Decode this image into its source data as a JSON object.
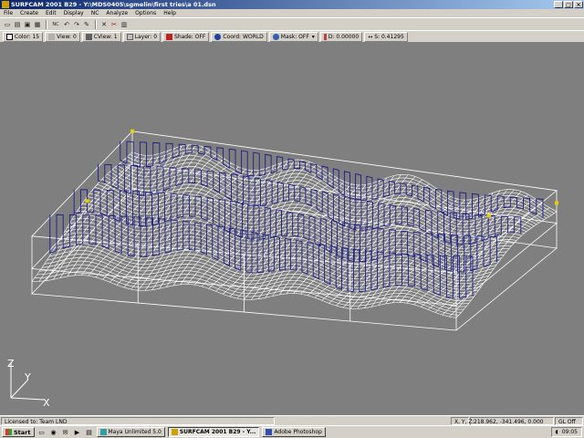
{
  "window": {
    "title": "SURFCAM 2001 B29 - Y:\\MDS0405\\sgmelin\\first tries\\a 01.dsn",
    "minimize": "_",
    "maximize": "□",
    "close": "×"
  },
  "menu": [
    "File",
    "Create",
    "Edit",
    "Display",
    "NC",
    "Analyze",
    "Options",
    "Help"
  ],
  "toolbar_icons": [
    {
      "name": "new-file-icon",
      "glyph": "▭"
    },
    {
      "name": "open-file-icon",
      "glyph": "▤"
    },
    {
      "name": "save-icon",
      "glyph": "▣"
    },
    {
      "name": "print-icon",
      "glyph": "▦"
    },
    {
      "name": "sep"
    },
    {
      "name": "nc-icon",
      "glyph": "NC"
    },
    {
      "name": "undo-icon",
      "glyph": "↶"
    },
    {
      "name": "redo-icon",
      "glyph": "↷"
    },
    {
      "name": "erase-icon",
      "glyph": "✎"
    },
    {
      "name": "sep"
    },
    {
      "name": "delete-icon",
      "glyph": "✕"
    },
    {
      "name": "trim-icon",
      "glyph": "✂"
    },
    {
      "name": "clipboard-icon",
      "glyph": "▥"
    }
  ],
  "status_toolbar": {
    "color": "Color: 15",
    "view": "View: 0",
    "cview": "CView: 1",
    "layer": "Layer: 0",
    "shade": "Shade: OFF",
    "coord": "Coord: WORLD",
    "mask": "Mask: OFF",
    "depth": "D: 0.00000",
    "step": "S: 0.41295"
  },
  "axis_labels": {
    "z": "Z",
    "y": "Y",
    "x": "X"
  },
  "status_bar": {
    "license": "Licensed to: Team LND",
    "xyz_label": "X, Y, Z:",
    "xyz_value": "218.962, -341.496, 0.000",
    "gl": "GL Off"
  },
  "taskbar": {
    "start": "Start",
    "tasks": [
      {
        "label": "Maya Unlimited 5.0",
        "active": false
      },
      {
        "label": "SURFCAM 2001 B29 - Y...",
        "active": true
      },
      {
        "label": "Adobe Photoshop",
        "active": false
      }
    ],
    "clock": "09:05"
  },
  "colors": {
    "wireframe": "#ffffff",
    "toolpath": "#1a1a8c",
    "viewport_bg": "#7f7f7f",
    "markers": "#e8d000"
  }
}
